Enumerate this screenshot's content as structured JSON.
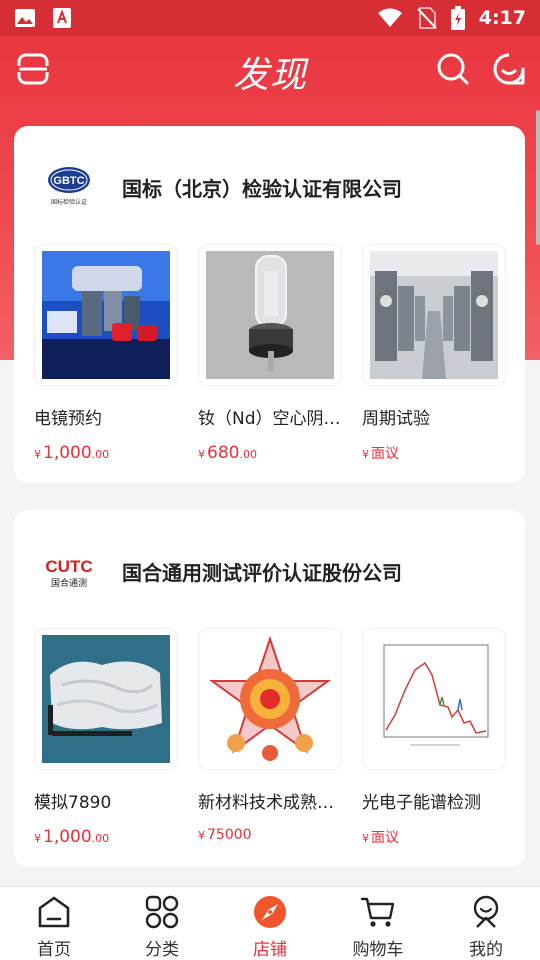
{
  "status_bar": {
    "time": "4:17"
  },
  "header": {
    "title": "发现"
  },
  "shops": [
    {
      "name": "国标（北京）检验认证有限公司",
      "logo_text": "GBTC",
      "logo_sub": "国标检验认证",
      "products": [
        {
          "name": "电镜预约",
          "currency": "¥",
          "price_int": "1,000",
          "price_dec": ".00"
        },
        {
          "name": "钕（Nd）空心阴极灯",
          "currency": "¥",
          "price_int": "680",
          "price_dec": ".00"
        },
        {
          "name": "周期试验",
          "currency": "¥",
          "price_int": "面议",
          "price_dec": ""
        }
      ]
    },
    {
      "name": "国合通用测试评价认证股份公司",
      "logo_text": "CUTC",
      "logo_sub": "国合通测",
      "products": [
        {
          "name": "模拟7890",
          "currency": "¥",
          "price_int": "1,000",
          "price_dec": ".00"
        },
        {
          "name": "新材料技术成熟度评价",
          "currency": "¥",
          "price_int": "75000",
          "price_dec": ""
        },
        {
          "name": "光电子能谱检测",
          "currency": "¥",
          "price_int": "面议",
          "price_dec": ""
        }
      ]
    }
  ],
  "tabs": [
    {
      "label": "首页",
      "icon": "home-icon"
    },
    {
      "label": "分类",
      "icon": "category-icon"
    },
    {
      "label": "店铺",
      "icon": "compass-icon",
      "active": true
    },
    {
      "label": "购物车",
      "icon": "cart-icon"
    },
    {
      "label": "我的",
      "icon": "profile-icon"
    }
  ],
  "colors": {
    "accent": "#e8313a",
    "header_bg": "#e8323c"
  }
}
